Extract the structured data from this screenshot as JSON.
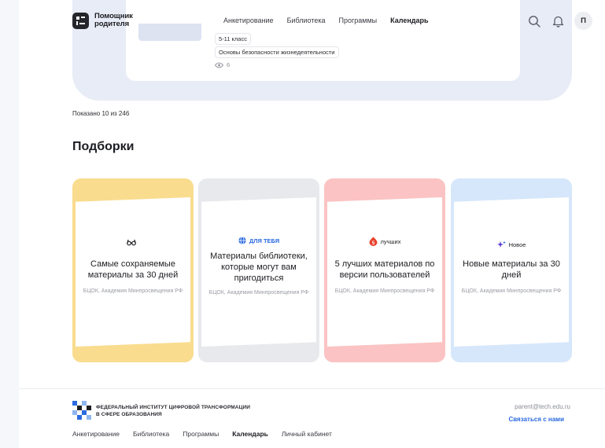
{
  "header": {
    "logo_text": "Помощник родителя",
    "nav": [
      {
        "label": "Анкетирование",
        "active": false
      },
      {
        "label": "Библиотека",
        "active": false
      },
      {
        "label": "Программы",
        "active": false
      },
      {
        "label": "Календарь",
        "active": true
      }
    ],
    "avatar_letter": "П",
    "icons": [
      "search-icon",
      "bell-icon"
    ]
  },
  "result_card": {
    "tags": [
      "5-11 класс",
      "Основы безопасности жизнедеятельности"
    ],
    "views": "6"
  },
  "shown_text": "Показано 10 из 246",
  "section_title": "Подборки",
  "collections": [
    {
      "badge": "",
      "badge_icon": "binoculars-icon",
      "title": "Самые сохраняемые материалы за 30 дней",
      "subtitle": "БЦОК, Академия Минпросвещения РФ",
      "color": "#f9dc8e"
    },
    {
      "badge": "ДЛЯ ТЕБЯ",
      "badge_icon": "globe-icon",
      "title": "Материалы библиотеки, которые могут вам пригодиться",
      "subtitle": "БЦОК, Академия Минпросвещения РФ",
      "color": "#e8e9ec"
    },
    {
      "badge": "лучших",
      "badge_icon": "fire-5-icon",
      "title": "5 лучших материалов по версии пользователей",
      "subtitle": "БЦОК, Академия Минпросвещения РФ",
      "color": "#fbc3c3"
    },
    {
      "badge": "Новое",
      "badge_icon": "sparkle-icon",
      "title": "Новые материалы за 30 дней",
      "subtitle": "БЦОК, Академия Минпросвещения РФ",
      "color": "#d6e7fb"
    }
  ],
  "footer": {
    "org_line1": "ФЕДЕРАЛЬНЫЙ ИНСТИТУТ ЦИФРОВОЙ ТРАНСФОРМАЦИИ",
    "org_line2": "В СФЕРЕ ОБРАЗОВАНИЯ",
    "email": "parent@tech.edu.ru",
    "contact": "Связаться с нами",
    "nav": [
      {
        "label": "Анкетирование",
        "active": false
      },
      {
        "label": "Библиотека",
        "active": false
      },
      {
        "label": "Программы",
        "active": false
      },
      {
        "label": "Календарь",
        "active": true
      },
      {
        "label": "Личный кабинет",
        "active": false
      }
    ]
  }
}
